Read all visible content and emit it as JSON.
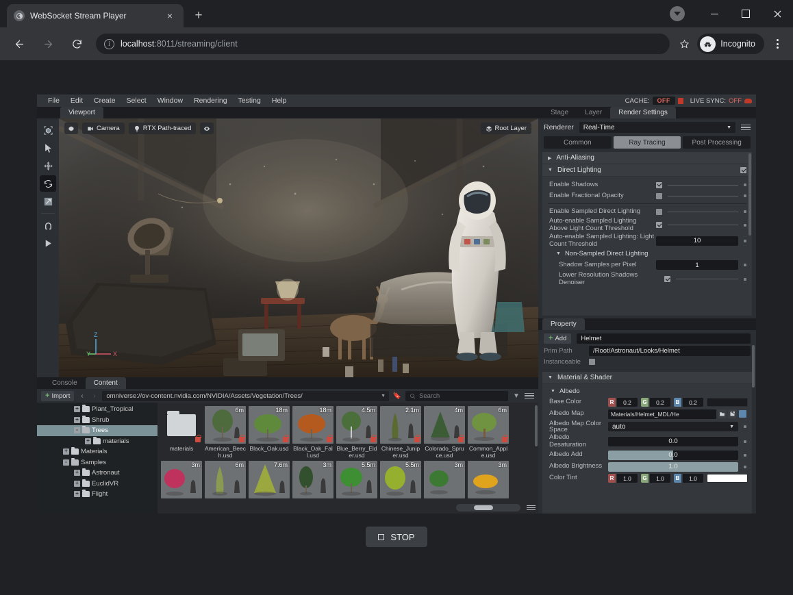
{
  "browser": {
    "tab": {
      "title": "WebSocket Stream Player",
      "favicon": "globe-icon",
      "close": "×"
    },
    "new_tab_label": "+",
    "window_controls": {
      "minimize": "minimize-icon",
      "maximize": "maximize-icon",
      "close": "✕"
    },
    "nav": {
      "back": "back-arrow-icon",
      "forward": "forward-arrow-icon",
      "reload": "reload-icon"
    },
    "omnibox": {
      "info_icon": "i",
      "url_host": "localhost",
      "url_rest": ":8011/streaming/client"
    },
    "bookmark": "star-icon",
    "profile": {
      "label": "Incognito",
      "icon": "incognito-icon"
    },
    "menu": "kebab-menu-icon"
  },
  "app": {
    "menubar": [
      "File",
      "Edit",
      "Create",
      "Select",
      "Window",
      "Rendering",
      "Testing",
      "Help"
    ],
    "status": {
      "cache_label": "CACHE:",
      "cache_value": "OFF",
      "live_sync_label": "LIVE SYNC:",
      "live_sync_value": "OFF"
    },
    "viewport": {
      "tab": "Viewport",
      "settings_icon": "gear-icon",
      "camera": "Camera",
      "render_mode": "RTX Path-traced",
      "eye_icon": "eye-icon",
      "root_layer": "Root Layer",
      "axis": {
        "x": "X",
        "y": "Y",
        "z": "Z"
      },
      "tools": [
        "select-box-icon",
        "cursor-arrow-icon",
        "move-icon",
        "rotate-icon",
        "scale-icon",
        "snap-magnet-icon",
        "play-icon"
      ]
    },
    "bottom_tabs": {
      "console": "Console",
      "content": "Content"
    },
    "content_browser": {
      "import": "Import",
      "nav_back": "‹",
      "nav_forward": "›",
      "path": "omniverse://ov-content.nvidia.com/NVIDIA/Assets/Vegetation/Trees/",
      "bookmark_icon": "bookmark-icon",
      "search_placeholder": "Search",
      "filter_icon": "filter-icon",
      "options_icon": "list-options-icon",
      "tree": [
        {
          "label": "Plant_Tropical",
          "depth": 3,
          "expand": "+",
          "selected": false
        },
        {
          "label": "Shrub",
          "depth": 3,
          "expand": "+",
          "selected": false
        },
        {
          "label": "Trees",
          "depth": 3,
          "expand": "-",
          "selected": true
        },
        {
          "label": "materials",
          "depth": 4,
          "expand": "+",
          "selected": false
        },
        {
          "label": "Materials",
          "depth": 2,
          "expand": "+",
          "selected": false
        },
        {
          "label": "Samples",
          "depth": 2,
          "expand": "-",
          "selected": false
        },
        {
          "label": "Astronaut",
          "depth": 3,
          "expand": "+",
          "selected": false
        },
        {
          "label": "EuclidVR",
          "depth": 3,
          "expand": "+",
          "selected": false
        },
        {
          "label": "Flight",
          "depth": 3,
          "expand": "+",
          "selected": false
        }
      ],
      "items_row1": [
        {
          "name": "materials",
          "size": "",
          "kind": "folder"
        },
        {
          "name": "American_Beech.usd",
          "size": "6m",
          "kind": "tree",
          "color": "#4e6b3e"
        },
        {
          "name": "Black_Oak.usd",
          "size": "18m",
          "kind": "tree",
          "color": "#5f8a3c"
        },
        {
          "name": "Black_Oak_Fall.usd",
          "size": "18m",
          "kind": "tree",
          "color": "#b55a1e"
        },
        {
          "name": "Blue_Berry_Elder.usd",
          "size": "4.5m",
          "kind": "tree",
          "color": "#4b6f3a"
        },
        {
          "name": "Chinese_Juniper.usd",
          "size": "2.1m",
          "kind": "tree",
          "color": "#5a6b32"
        },
        {
          "name": "Colorado_Spruce.usd",
          "size": "4m",
          "kind": "tree",
          "color": "#3c5c36"
        },
        {
          "name": "Common_Apple.usd",
          "size": "6m",
          "kind": "tree",
          "color": "#6f9340"
        }
      ],
      "items_row2": [
        {
          "name": "",
          "size": "3m",
          "kind": "tree",
          "color": "#c0325e"
        },
        {
          "name": "",
          "size": "6m",
          "kind": "tree",
          "color": "#8a9a50"
        },
        {
          "name": "",
          "size": "7.6m",
          "kind": "tree",
          "color": "#9aa83f"
        },
        {
          "name": "",
          "size": "3m",
          "kind": "tree",
          "color": "#33502e"
        },
        {
          "name": "",
          "size": "5.5m",
          "kind": "tree",
          "color": "#3e8f33"
        },
        {
          "name": "",
          "size": "5.5m",
          "kind": "tree",
          "color": "#95b02e"
        },
        {
          "name": "",
          "size": "3m",
          "kind": "tree",
          "color": "#3c7a34"
        },
        {
          "name": "",
          "size": "3m",
          "kind": "tree",
          "color": "#e0a31c"
        }
      ]
    },
    "right_panel": {
      "tabs": [
        "Stage",
        "Layer",
        "Render Settings"
      ],
      "active_tab": "Render Settings",
      "renderer_label": "Renderer",
      "renderer_value": "Real-Time",
      "segments": [
        "Common",
        "Ray Tracing",
        "Post Processing"
      ],
      "active_segment": "Ray Tracing",
      "sections": [
        {
          "title": "Anti-Aliasing",
          "expanded": false,
          "checked": null
        },
        {
          "title": "Direct Lighting",
          "expanded": true,
          "checked": true
        }
      ],
      "rows": [
        {
          "label": "Enable Shadows",
          "type": "checkbox",
          "value": true
        },
        {
          "label": "Enable Fractional Opacity",
          "type": "checkbox",
          "value": false
        },
        {
          "label": "Enable Sampled Direct Lighting",
          "type": "checkbox",
          "value": false
        },
        {
          "label": "Auto-enable Sampled Lighting Above Light Count Threshold",
          "type": "checkbox",
          "value": true
        },
        {
          "label": "Auto-enable Sampled Lighting: Light Count Threshold",
          "type": "number",
          "value": "10"
        }
      ],
      "subsection": "Non-Sampled Direct Lighting",
      "sub_rows": [
        {
          "label": "Shadow Samples per Pixel",
          "type": "number",
          "value": "1"
        },
        {
          "label": "Lower Resolution Shadows Denoiser",
          "type": "checkbox",
          "value": true
        }
      ]
    },
    "property_panel": {
      "tab": "Property",
      "add_button": "Add",
      "name_value": "Helmet",
      "prim_path_label": "Prim Path",
      "prim_path_value": "/Root/Astronaut/Looks/Helmet",
      "instanceable_label": "Instanceable",
      "instanceable_value": false,
      "material_section": "Material & Shader",
      "albedo_section": "Albedo",
      "base_color": {
        "label": "Base Color",
        "r": "0.2",
        "g": "0.2",
        "b": "0.2"
      },
      "albedo_map": {
        "label": "Albedo Map",
        "value": "Materials/Helmet_MDL/He"
      },
      "albedo_color_space": {
        "label": "Albedo Map Color Space",
        "value": "auto"
      },
      "albedo_desaturation": {
        "label": "Albedo Desaturation",
        "value": "0.0",
        "fill": 0
      },
      "albedo_add": {
        "label": "Albedo Add",
        "value": "0.0",
        "fill": 50
      },
      "albedo_brightness": {
        "label": "Albedo Brightness",
        "value": "1.0",
        "fill": 100
      },
      "color_tint": {
        "label": "Color Tint",
        "r": "1.0",
        "g": "1.0",
        "b": "1.0"
      },
      "channels": {
        "r": "R",
        "g": "G",
        "b": "B"
      }
    }
  },
  "player": {
    "stop_label": "STOP",
    "stop_icon": "stop-square-icon"
  },
  "colors": {
    "accent_red": "#e0645c",
    "accent_green": "#76b36f",
    "selection": "#7c9299",
    "slider_fill": "#8b9ea3"
  }
}
